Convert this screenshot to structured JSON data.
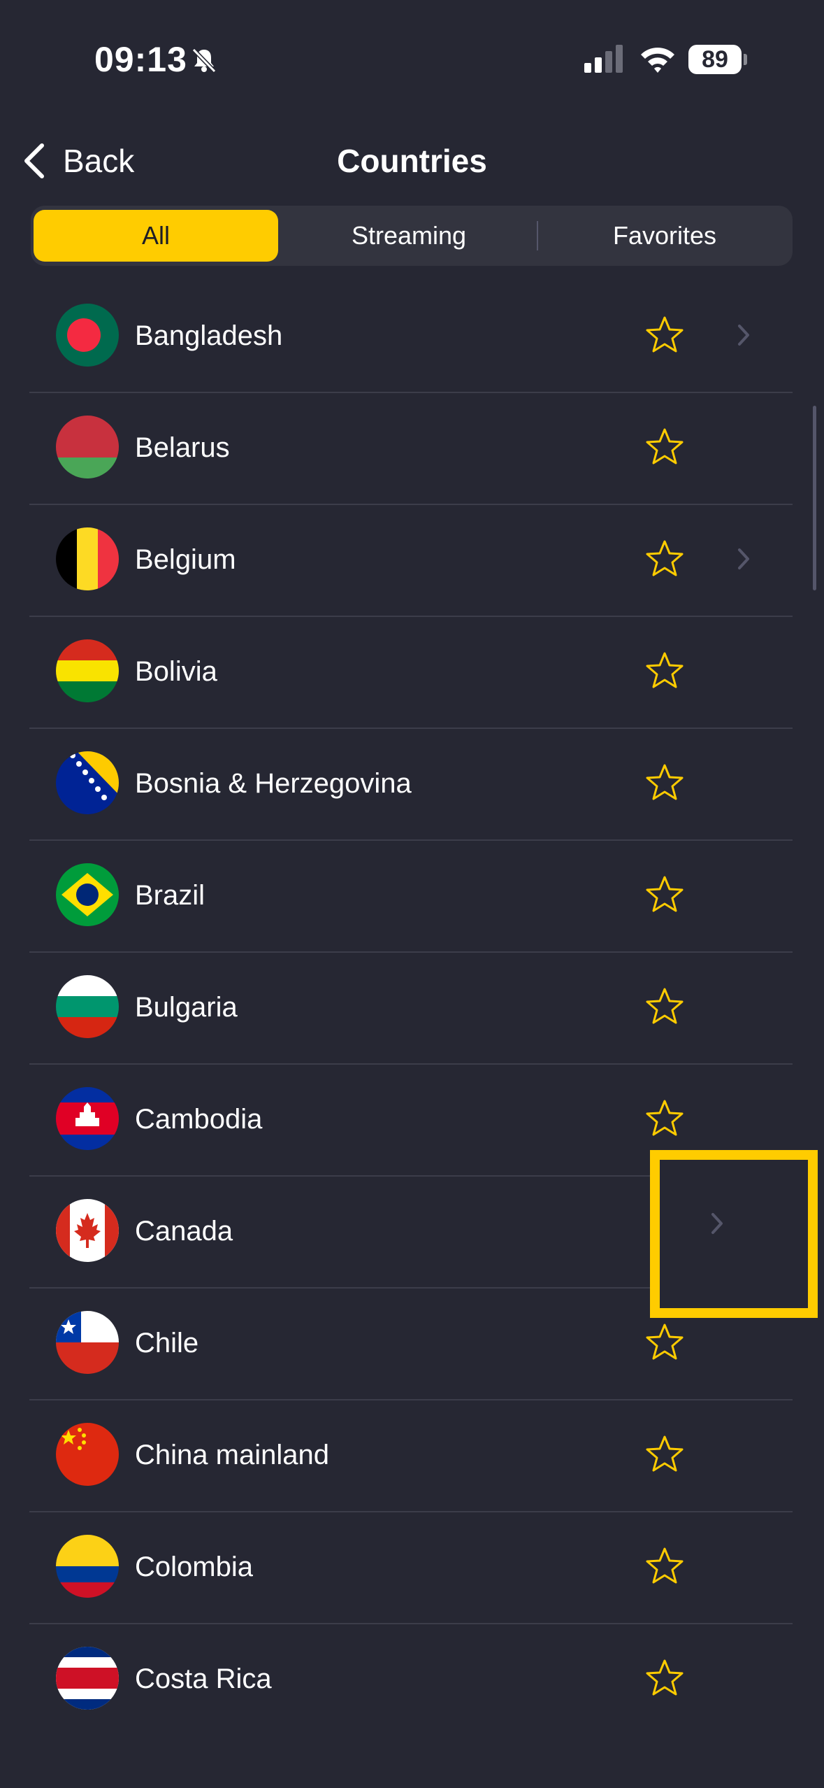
{
  "status_bar": {
    "time": "09:13",
    "battery": "89"
  },
  "nav": {
    "back_label": "Back",
    "title": "Countries"
  },
  "tabs": [
    {
      "label": "All",
      "active": true
    },
    {
      "label": "Streaming",
      "active": false
    },
    {
      "label": "Favorites",
      "active": false
    }
  ],
  "countries": [
    {
      "name": "Bangladesh",
      "has_chevron": true
    },
    {
      "name": "Belarus",
      "has_chevron": false
    },
    {
      "name": "Belgium",
      "has_chevron": true
    },
    {
      "name": "Bolivia",
      "has_chevron": false
    },
    {
      "name": "Bosnia & Herzegovina",
      "has_chevron": false
    },
    {
      "name": "Brazil",
      "has_chevron": false
    },
    {
      "name": "Bulgaria",
      "has_chevron": false
    },
    {
      "name": "Cambodia",
      "has_chevron": false
    },
    {
      "name": "Canada",
      "has_chevron": true
    },
    {
      "name": "Chile",
      "has_chevron": false
    },
    {
      "name": "China mainland",
      "has_chevron": false
    },
    {
      "name": "Colombia",
      "has_chevron": false
    },
    {
      "name": "Costa Rica",
      "has_chevron": false
    }
  ],
  "colors": {
    "accent": "#ffcc00",
    "background": "#262733"
  }
}
